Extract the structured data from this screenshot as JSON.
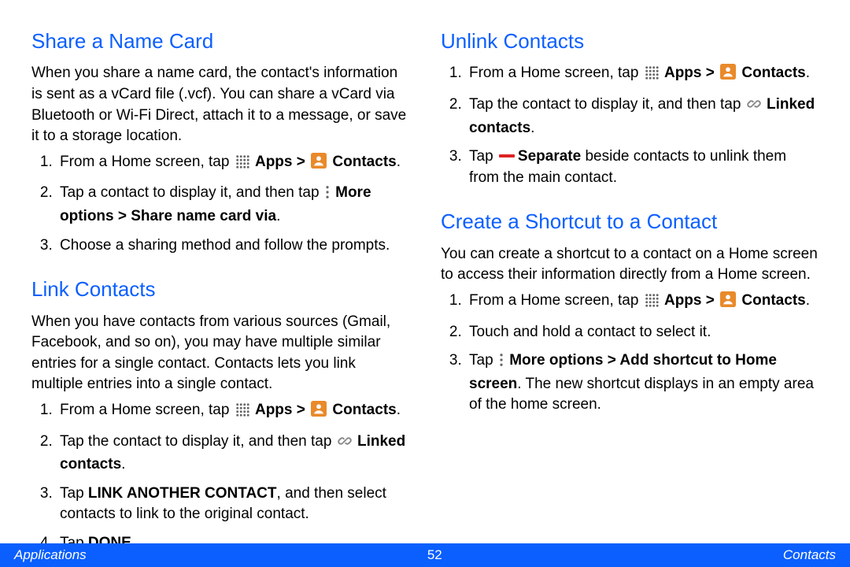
{
  "footer": {
    "left": "Applications",
    "page": "52",
    "right": "Contacts"
  },
  "left_col": {
    "h_share": "Share a Name Card",
    "share_intro": "When you share a name card, the contact's information is sent as a vCard file (.vcf). You can share a vCard via Bluetooth or Wi-Fi Direct, attach it to a message, or save it to a storage location.",
    "share_1_a": "From a Home screen, tap ",
    "share_2_a": "Tap a contact to display it, and then tap ",
    "share_2_b": "More options > Share name card via",
    "share_3": "Choose a sharing method and follow the prompts.",
    "h_link": "Link Contacts",
    "link_intro": "When you have contacts from various sources (Gmail, Facebook, and so on), you may have multiple similar entries for a single contact. Contacts lets you link multiple entries into a single contact.",
    "link_1_a": "From a Home screen, tap ",
    "link_2_a": "Tap the contact to display it, and then tap ",
    "link_2_b": "Linked contacts",
    "link_3_a": "Tap ",
    "link_3_b": "LINK ANOTHER CONTACT",
    "link_3_c": ", and then select contacts to link to the original contact.",
    "link_4_a": "Tap ",
    "link_4_b": "DONE",
    "link_4_c": "."
  },
  "right_col": {
    "h_unlink": "Unlink Contacts",
    "unlink_1_a": "From a Home screen, tap ",
    "unlink_2_a": "Tap the contact to display it, and then tap ",
    "unlink_2_b": "Linked contacts",
    "unlink_3_a": "Tap ",
    "unlink_3_b": "Separate",
    "unlink_3_c": " beside contacts to unlink them from the main contact.",
    "h_shortcut": "Create a Shortcut to a Contact",
    "shortcut_intro": "You can create a shortcut to a contact on a Home screen to access their information directly from a Home screen.",
    "shortcut_1_a": "From a Home screen, tap ",
    "shortcut_2": "Touch and hold a contact to select it.",
    "shortcut_3_a": "Tap ",
    "shortcut_3_b": "More options > Add shortcut to Home screen",
    "shortcut_3_c": ". The new shortcut displays in an empty area of the home screen."
  },
  "labels": {
    "apps": "Apps >",
    "contacts": "Contacts",
    "period": "."
  }
}
